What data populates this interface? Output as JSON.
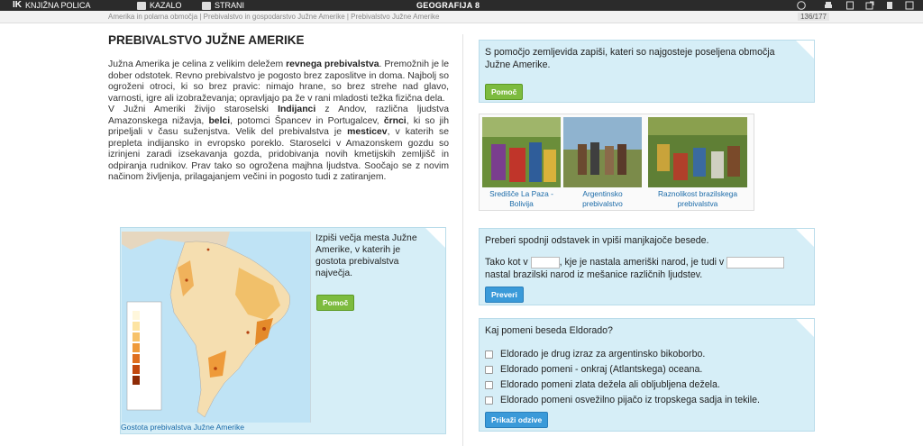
{
  "topbar": {
    "library_label": "KNJIŽNA POLICA",
    "toc_label": "KAZALO",
    "pages_label": "STRANI",
    "book_title": "GEOGRAFIJA 8"
  },
  "subbar": {
    "breadcrumb": "Amerika in polarna območja | Prebivalstvo in gospodarstvo Južne Amerike | Prebivalstvo Južne Amerike",
    "page_counter": "136/177"
  },
  "article": {
    "title": "PREBIVALSTVO JUŽNE AMERIKE",
    "p1_a": "Južna Amerika je celina z velikim deležem ",
    "p1_b": "revnega prebivalstva",
    "p1_c": ". Premožnih je le dober odstotek. Revno prebivalstvo je pogosto brez zaposlitve in doma. Najbolj so ogroženi otroci, ki so brez pravic: nimajo hrane, so brez strehe nad glavo, varnosti, igre ali izobraževanja; opravljajo pa že v rani mladosti težka fizična dela.",
    "p2_a": "V Južni Ameriki živijo staroselski ",
    "p2_b": "Indijanci",
    "p2_c": " z Andov, različna ljudstva Amazonskega nižavja, ",
    "p2_d": "belci",
    "p2_e": ", potomci Špancev in Portugalcev, ",
    "p2_f": "črnci",
    "p2_g": ", ki so jih pripeljali v času suženjstva. Velik del prebivalstva je ",
    "p2_h": "mesticev",
    "p2_i": ", v katerih se prepleta indijansko in evropsko poreklo. Staroselci v Amazonskem gozdu so izrinjeni zaradi izsekavanja gozda, pridobivanja novih kmetijskih zemljišč in odpiranja rudnikov. Prav tako so ogrožena majhna ljudstva. Soočajo se z novim načinom življenja, prilagajanjem večini in pogosto tudi z zatiranjem."
  },
  "map_task": {
    "question": "Izpiši večja mesta Južne Amerike, v katerih je gostota prebivalstva največja.",
    "help_button": "Pomoč",
    "caption": "Gostota prebivalstva Južne Amerike"
  },
  "task1": {
    "question": "S pomočjo zemljevida zapiši, kateri so najgosteje poseljena območja Južne Amerike.",
    "help_button": "Pomoč"
  },
  "photos": [
    {
      "caption": "Središče La Paza - Bolivija"
    },
    {
      "caption": "Argentinsko prebivalstvo"
    },
    {
      "caption": "Raznolikost brazilskega prebivalstva"
    }
  ],
  "task2": {
    "instruction": "Preberi spodnji odstavek in vpiši manjkajoče besede.",
    "sentence_a": "Tako kot v",
    "sentence_b": ", kje je nastala ameriški narod, je tudi v",
    "sentence_c": "nastal brazilski narod iz mešanice različnih ljudstev.",
    "check_button": "Preveri"
  },
  "task3": {
    "question": "Kaj pomeni beseda Eldorado?",
    "options": [
      "Eldorado je drug izraz za argentinsko bikoborbo.",
      "Eldorado pomeni - onkraj (Atlantskega) oceana.",
      "Eldorado pomeni zlata dežela ali obljubljena dežela.",
      "Eldorado pomeni osvežilno pijačo iz tropskega sadja in tekile."
    ],
    "show_answers_button": "Prikaži odzive"
  },
  "colors": {
    "box_bg": "#d6eef7",
    "green_button": "#7dbb3f",
    "blue_button": "#3a9ad9",
    "link_blue": "#1a6aa8",
    "topbar": "#2b2b2b"
  }
}
